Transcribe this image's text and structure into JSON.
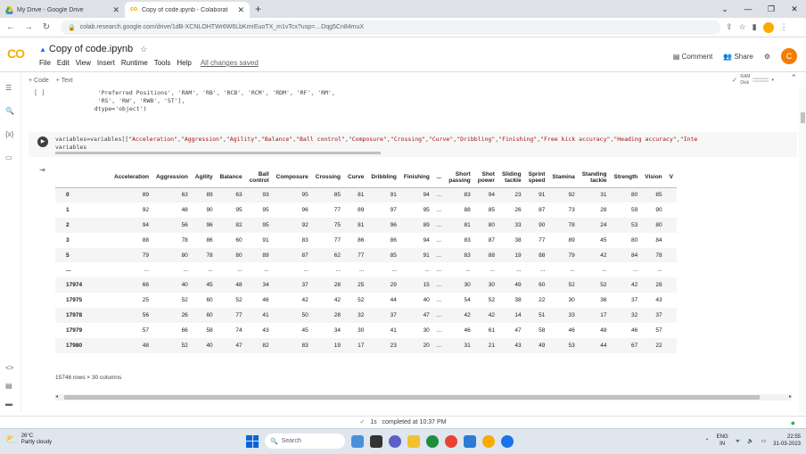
{
  "browser": {
    "tabs": [
      {
        "label": "My Drive - Google Drive",
        "active": false
      },
      {
        "label": "Copy of code.ipynb - Colaborat",
        "active": true
      }
    ],
    "new_tab": "+",
    "url": "colab.research.google.com/drive/1dB-XCNLOHTWr6W6LbKmrEuoTX_m1vTcx?usp=…Dqg5Cn84muX",
    "window_controls": [
      "⌄",
      "—",
      "❐",
      "✕"
    ]
  },
  "colab": {
    "logo": "CO",
    "notebook_title": "Copy of code.ipynb",
    "menu": [
      "File",
      "Edit",
      "View",
      "Insert",
      "Runtime",
      "Tools",
      "Help"
    ],
    "save_status": "All changes saved",
    "comment_label": "Comment",
    "share_label": "Share",
    "avatar_letter": "C",
    "add_code": "+ Code",
    "add_text": "+ Text",
    "ram_label": "RAM",
    "disk_label": "Disk"
  },
  "cells": {
    "cell1_brackets": "[ ]",
    "cell1_code": "    'Preferred Positions', 'RAM', 'RB', 'RCB', 'RCM', 'RDM', 'RF', 'RM',\n    'RS', 'RW', 'RWB', 'ST'],\n   dtype='object')",
    "cell2_code_prefix": "variables=variables[[",
    "cell2_strings": [
      "\"Acceleration\"",
      "\"Aggression\"",
      "\"Agility\"",
      "\"Balance\"",
      "\"Ball control\"",
      "\"Composure\"",
      "\"Crossing\"",
      "\"Curve\"",
      "\"Dribbling\"",
      "\"Finishing\"",
      "\"Free kick accuracy\"",
      "\"Heading accuracy\"",
      "\"Inte"
    ],
    "cell2_line2": "variables"
  },
  "dataframe": {
    "columns": [
      "",
      "Acceleration",
      "Aggression",
      "Agility",
      "Balance",
      "Ball control",
      "Composure",
      "Crossing",
      "Curve",
      "Dribbling",
      "Finishing",
      "...",
      "Short passing",
      "Shot power",
      "Sliding tackle",
      "Sprint speed",
      "Stamina",
      "Standing tackle",
      "Strength",
      "Vision",
      "V"
    ],
    "rows": [
      [
        "0",
        "89",
        "63",
        "89",
        "63",
        "93",
        "95",
        "85",
        "81",
        "91",
        "94",
        "...",
        "83",
        "94",
        "23",
        "91",
        "92",
        "31",
        "80",
        "85",
        ""
      ],
      [
        "1",
        "92",
        "48",
        "90",
        "95",
        "95",
        "96",
        "77",
        "89",
        "97",
        "95",
        "...",
        "88",
        "85",
        "26",
        "87",
        "73",
        "28",
        "59",
        "90",
        ""
      ],
      [
        "2",
        "94",
        "56",
        "96",
        "82",
        "95",
        "92",
        "75",
        "81",
        "96",
        "89",
        "...",
        "81",
        "80",
        "33",
        "90",
        "78",
        "24",
        "53",
        "80",
        ""
      ],
      [
        "3",
        "88",
        "78",
        "86",
        "60",
        "91",
        "83",
        "77",
        "86",
        "86",
        "94",
        "...",
        "83",
        "87",
        "38",
        "77",
        "89",
        "45",
        "80",
        "84",
        ""
      ],
      [
        "5",
        "79",
        "80",
        "78",
        "80",
        "89",
        "87",
        "62",
        "77",
        "85",
        "91",
        "...",
        "83",
        "88",
        "19",
        "88",
        "79",
        "42",
        "84",
        "78",
        ""
      ],
      [
        "...",
        "...",
        "...",
        "...",
        "...",
        "...",
        "...",
        "...",
        "...",
        "...",
        "...",
        "...",
        "...",
        "...",
        "...",
        "...",
        "...",
        "...",
        "...",
        "...",
        ""
      ],
      [
        "17974",
        "66",
        "40",
        "45",
        "48",
        "34",
        "37",
        "28",
        "25",
        "29",
        "15",
        "...",
        "30",
        "30",
        "49",
        "60",
        "52",
        "52",
        "42",
        "28",
        ""
      ],
      [
        "17975",
        "25",
        "52",
        "60",
        "52",
        "46",
        "42",
        "42",
        "52",
        "44",
        "40",
        "...",
        "54",
        "52",
        "38",
        "22",
        "30",
        "36",
        "37",
        "43",
        ""
      ],
      [
        "17978",
        "56",
        "26",
        "60",
        "77",
        "41",
        "50",
        "28",
        "32",
        "37",
        "47",
        "...",
        "42",
        "42",
        "14",
        "51",
        "33",
        "17",
        "32",
        "37",
        ""
      ],
      [
        "17979",
        "57",
        "66",
        "58",
        "74",
        "43",
        "45",
        "34",
        "30",
        "41",
        "30",
        "...",
        "46",
        "61",
        "47",
        "58",
        "46",
        "48",
        "46",
        "57",
        ""
      ],
      [
        "17980",
        "48",
        "52",
        "40",
        "47",
        "82",
        "83",
        "19",
        "17",
        "23",
        "20",
        "...",
        "31",
        "21",
        "43",
        "49",
        "53",
        "44",
        "67",
        "22",
        ""
      ]
    ],
    "shape_text": "15746 rows × 30 columns"
  },
  "status": {
    "check": "✓",
    "duration": "1s",
    "text": "completed at 10:37 PM"
  },
  "taskbar": {
    "temp": "26°C",
    "weather": "Partly cloudy",
    "search": "Search",
    "lang_line1": "ENG",
    "lang_line2": "IN",
    "time": "22:55",
    "date": "31-03-2023"
  },
  "colors": {
    "accent": "#1a73e8",
    "colab_orange": "#f9ab00",
    "ok_green": "#34a853"
  }
}
